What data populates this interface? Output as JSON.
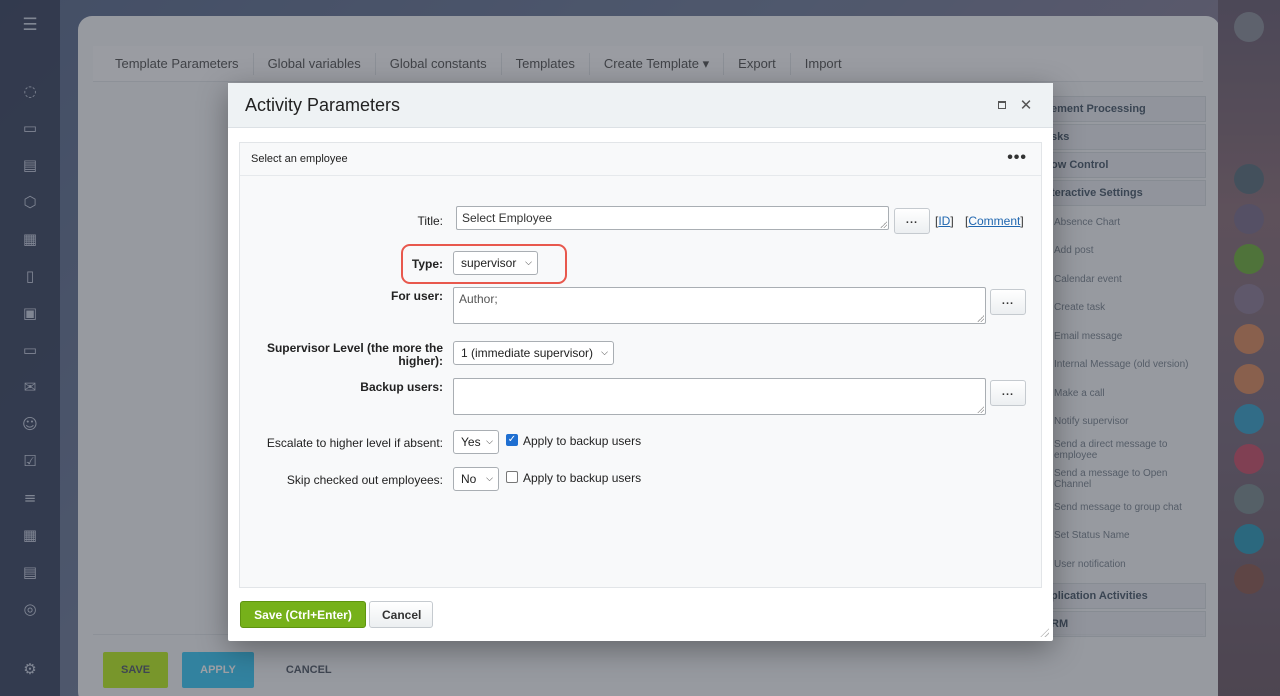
{
  "background": {
    "tabs": [
      "Template Parameters",
      "Global variables",
      "Global constants",
      "Templates",
      "Create Template ▾",
      "Export",
      "Import"
    ],
    "side_groups": [
      {
        "title": "ement Processing"
      },
      {
        "title": "sks"
      },
      {
        "title": "ow Control"
      },
      {
        "title": "teractive Settings"
      }
    ],
    "side_items": [
      "Absence Chart",
      "Add post",
      "Calendar event",
      "Create task",
      "Email message",
      "Internal Message (old version)",
      "Make a call",
      "Notify supervisor",
      "Send a direct message to employee",
      "Send a message to Open Channel",
      "Send message to group chat",
      "Set Status Name",
      "User notification"
    ],
    "side_groups_bottom": [
      {
        "title": "plication Activities"
      },
      {
        "title": "RM"
      }
    ],
    "buttons": {
      "save": "SAVE",
      "apply": "APPLY",
      "cancel": "CANCEL"
    }
  },
  "modal": {
    "title": "Activity Parameters",
    "panel_title": "Select an employee",
    "more": "•••",
    "fields": {
      "title_label": "Title:",
      "title_value": "Select Employee",
      "id_link": "ID",
      "comment_link": "Comment",
      "type_label": "Type:",
      "type_value": "supervisor",
      "for_user_label": "For user:",
      "for_user_value": "Author;",
      "supervisor_level_label_1": "Supervisor Level (the more the",
      "supervisor_level_label_2": "higher):",
      "supervisor_level_value": "1 (immediate supervisor)",
      "backup_users_label": "Backup users:",
      "backup_users_value": "",
      "escalate_label": "Escalate to higher level if absent:",
      "escalate_value": "Yes",
      "escalate_apply_label": "Apply to backup users",
      "skip_label": "Skip checked out employees:",
      "skip_value": "No",
      "skip_apply_label": "Apply to backup users"
    },
    "dots_label": "...",
    "save_label": "Save (Ctrl+Enter)",
    "cancel_label": "Cancel"
  },
  "checkboxes": {
    "escalate_apply": true,
    "skip_apply": false
  }
}
